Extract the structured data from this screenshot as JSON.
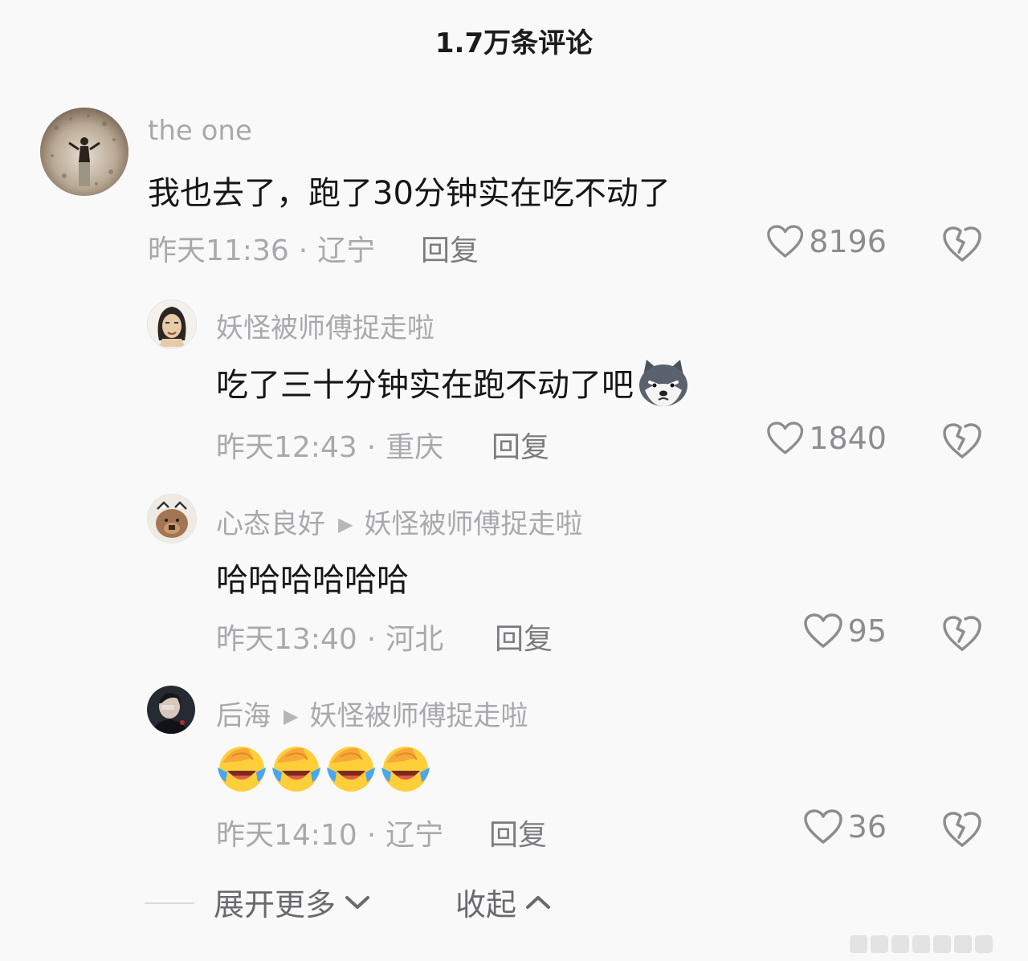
{
  "header": {
    "title": "1.7万条评论"
  },
  "comments": [
    {
      "username": "the one",
      "text": "我也去了，跑了30分钟实在吃不动了",
      "time": "昨天11:36",
      "location": "辽宁",
      "reply_label": "回复",
      "likes": "8196"
    },
    {
      "username": "妖怪被师傅捉走啦",
      "text": "吃了三十分钟实在跑不动了吧",
      "time": "昨天12:43",
      "location": "重庆",
      "reply_label": "回复",
      "likes": "1840",
      "emoji": "husky-emoji"
    },
    {
      "username": "心态良好",
      "reply_to": "妖怪被师傅捉走啦",
      "text": "哈哈哈哈哈哈",
      "time": "昨天13:40",
      "location": "河北",
      "reply_label": "回复",
      "likes": "95"
    },
    {
      "username": "后海",
      "reply_to": "妖怪被师傅捉走啦",
      "text": "",
      "emojis": [
        "cry-laugh-emoji",
        "cry-laugh-emoji",
        "cry-laugh-emoji",
        "cry-laugh-emoji"
      ],
      "time": "昨天14:10",
      "location": "辽宁",
      "reply_label": "回复",
      "likes": "36"
    }
  ],
  "footer": {
    "expand_label": "展开更多",
    "collapse_label": "收起"
  },
  "colors": {
    "secondary_text": "#a9a9ad",
    "primary_text": "#161616",
    "background": "#f9f9f9"
  }
}
